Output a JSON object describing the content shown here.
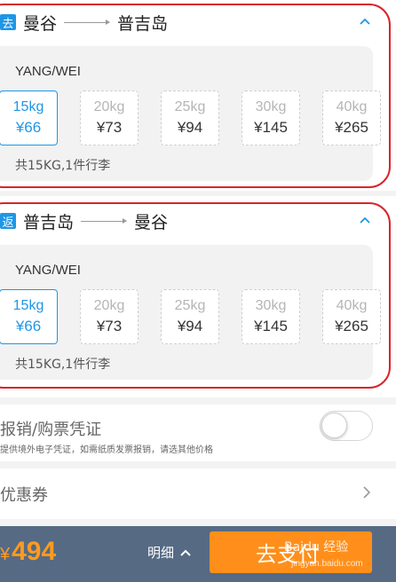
{
  "outbound": {
    "badge": "去",
    "from": "曼谷",
    "to": "普吉岛",
    "passenger": "YANG/WEI",
    "options": [
      {
        "weight": "15kg",
        "price": "¥66",
        "selected": true
      },
      {
        "weight": "20kg",
        "price": "¥73",
        "selected": false
      },
      {
        "weight": "25kg",
        "price": "¥94",
        "selected": false
      },
      {
        "weight": "30kg",
        "price": "¥145",
        "selected": false
      },
      {
        "weight": "40kg",
        "price": "¥265",
        "selected": false
      }
    ],
    "note": "共15KG,1件行李"
  },
  "return": {
    "badge": "返",
    "from": "普吉岛",
    "to": "曼谷",
    "passenger": "YANG/WEI",
    "options": [
      {
        "weight": "15kg",
        "price": "¥66",
        "selected": true
      },
      {
        "weight": "20kg",
        "price": "¥73",
        "selected": false
      },
      {
        "weight": "25kg",
        "price": "¥94",
        "selected": false
      },
      {
        "weight": "30kg",
        "price": "¥145",
        "selected": false
      },
      {
        "weight": "40kg",
        "price": "¥265",
        "selected": false
      }
    ],
    "note": "共15KG,1件行李"
  },
  "invoice": {
    "title": "报销/购票凭证",
    "subtitle": "提供境外电子凭证，如需纸质发票报销，请选其他价格",
    "toggle_on": false
  },
  "coupon": {
    "label": "优惠券"
  },
  "footer": {
    "currency": "¥",
    "total": "494",
    "detail_label": "明细",
    "pay_label": "去支付"
  },
  "watermark": {
    "text": "Baidu 经验",
    "url": "jingyan.baidu.com"
  },
  "colors": {
    "accent": "#1e96e6",
    "highlight_outline": "#d9242b",
    "pay": "#ff8f1a",
    "bar": "#566a84"
  }
}
